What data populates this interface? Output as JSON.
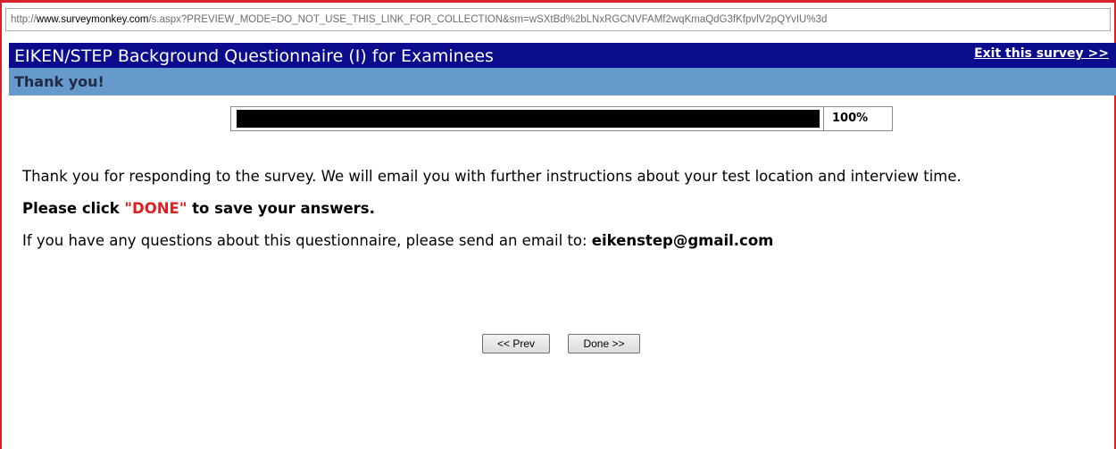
{
  "browser": {
    "url_scheme": "http://",
    "url_host": "www.surveymonkey.com",
    "url_path": "/s.aspx?PREVIEW_MODE=DO_NOT_USE_THIS_LINK_FOR_COLLECTION&sm=wSXtBd%2bLNxRGCNVFAMf2wqKmaQdG3fKfpvlV2pQYvIU%3d"
  },
  "survey": {
    "title": "EIKEN/STEP Background Questionnaire (I) for Examinees",
    "exit_label": "Exit this survey >>",
    "page_title": "Thank you!"
  },
  "progress": {
    "value": 1.0,
    "label": "100%"
  },
  "content": {
    "thanks_text": "Thank you for responding to the survey. We will email you with further instructions about your test location and interview time.",
    "instruction_prefix": "Please click ",
    "instruction_done": "\"DONE\"",
    "instruction_suffix": " to save your answers.",
    "contact_text": "If you have any questions about this questionnaire, please send an email to: ",
    "contact_email": "eikenstep@gmail.com"
  },
  "navigation": {
    "prev_label": "<< Prev",
    "done_label": "Done >>"
  },
  "colors": {
    "title_bar": "#0b0b8e",
    "page_header": "#6699cc",
    "done_highlight": "#e02020",
    "window_border": "#d8232a"
  }
}
